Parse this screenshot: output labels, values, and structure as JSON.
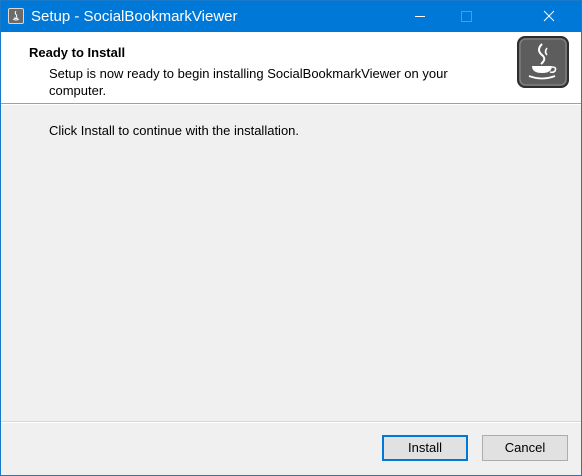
{
  "window": {
    "title": "Setup - SocialBookmarkViewer",
    "icon": "java-coffee-cup-icon",
    "controls": [
      "minimize-icon",
      "maximize-icon",
      "close-icon"
    ],
    "accent_color": "#0078d7"
  },
  "header": {
    "title": "Ready to Install",
    "description": "Setup is now ready to begin installing SocialBookmarkViewer on your computer.",
    "logo_icon": "java-coffee-cup-icon"
  },
  "main": {
    "message": "Click Install to continue with the installation."
  },
  "buttons": {
    "install_label": "Install",
    "cancel_label": "Cancel"
  }
}
